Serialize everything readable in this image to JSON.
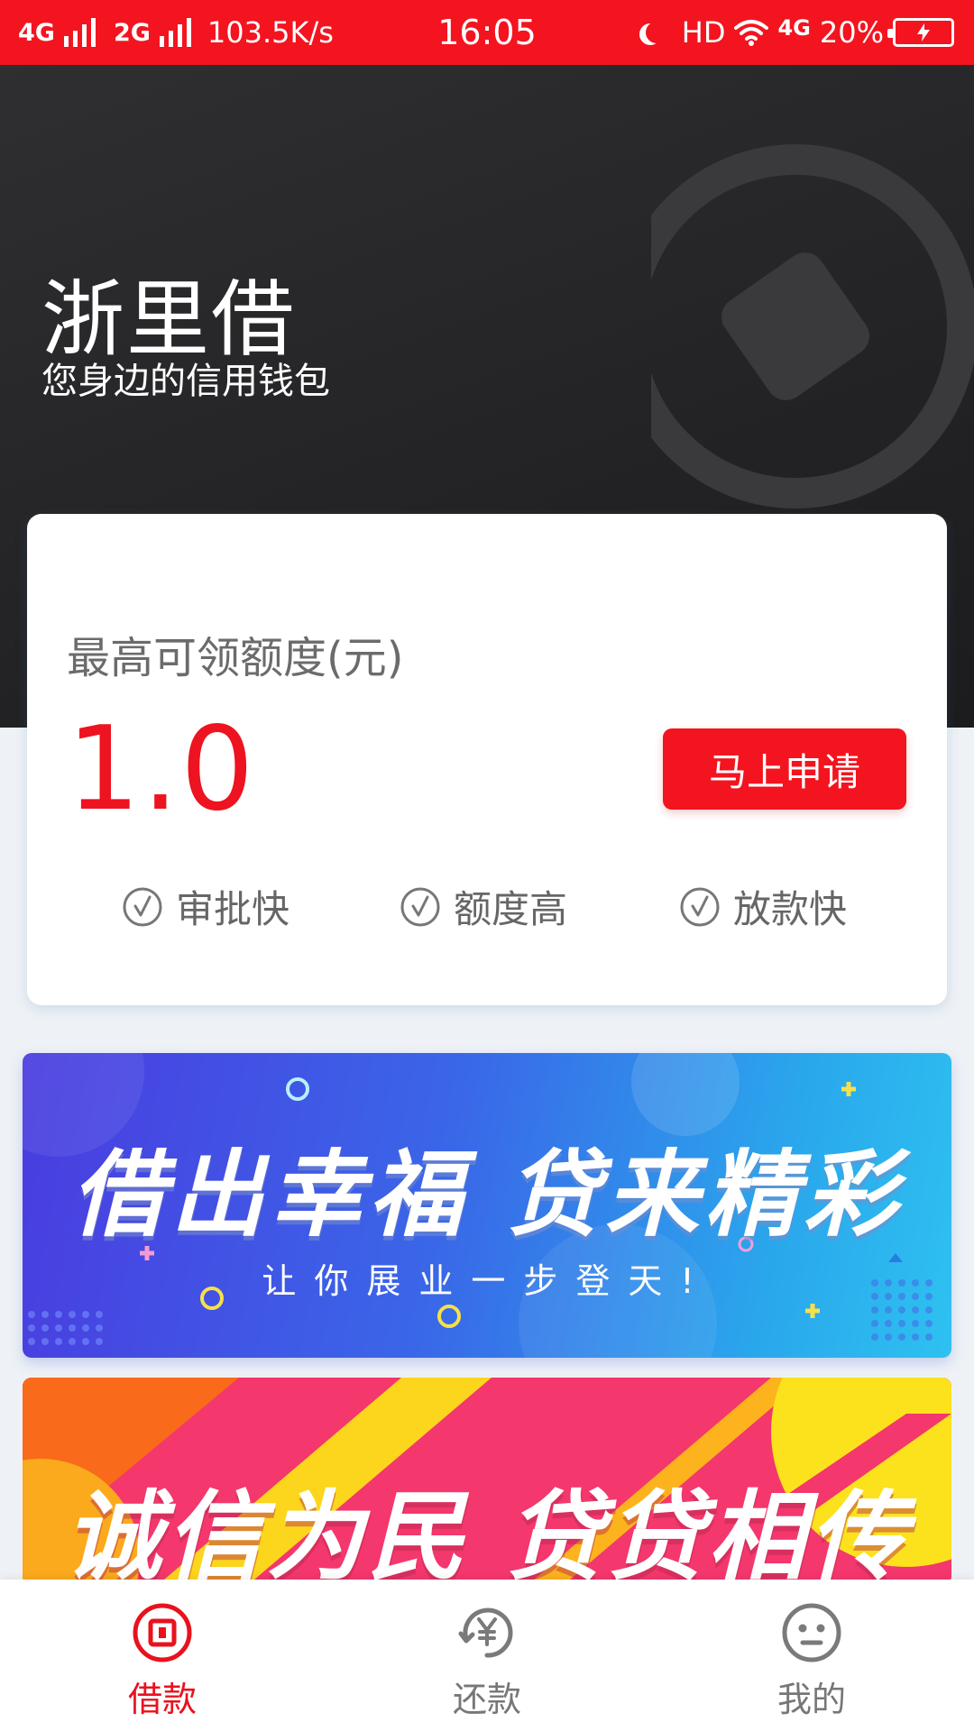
{
  "status_bar": {
    "net1": "4G",
    "net2": "2G",
    "speed": "103.5K/s",
    "time": "16:05",
    "hd": "HD",
    "wifi_net": "4G",
    "battery": "20%"
  },
  "header": {
    "app_name": "浙里借",
    "slogan": "您身边的信用钱包"
  },
  "credit_card": {
    "limit_label": "最高可领额度(元)",
    "limit_value": "1.0",
    "apply_button": "马上申请",
    "features": [
      "审批快",
      "额度高",
      "放款快"
    ]
  },
  "banners": [
    {
      "title": "借出幸福  贷来精彩",
      "subtitle": "让你展业一步登天!"
    },
    {
      "title": "诚信为民  贷贷相传"
    }
  ],
  "bottom_nav": {
    "items": [
      {
        "label": "借款",
        "icon": "loan-icon",
        "active": true
      },
      {
        "label": "还款",
        "icon": "repay-yuan-icon",
        "active": false
      },
      {
        "label": "我的",
        "icon": "profile-face-icon",
        "active": false
      }
    ]
  },
  "colors": {
    "brand_red": "#f3141f",
    "header_dark": "#2a2a2c",
    "background": "#eef2f6"
  }
}
